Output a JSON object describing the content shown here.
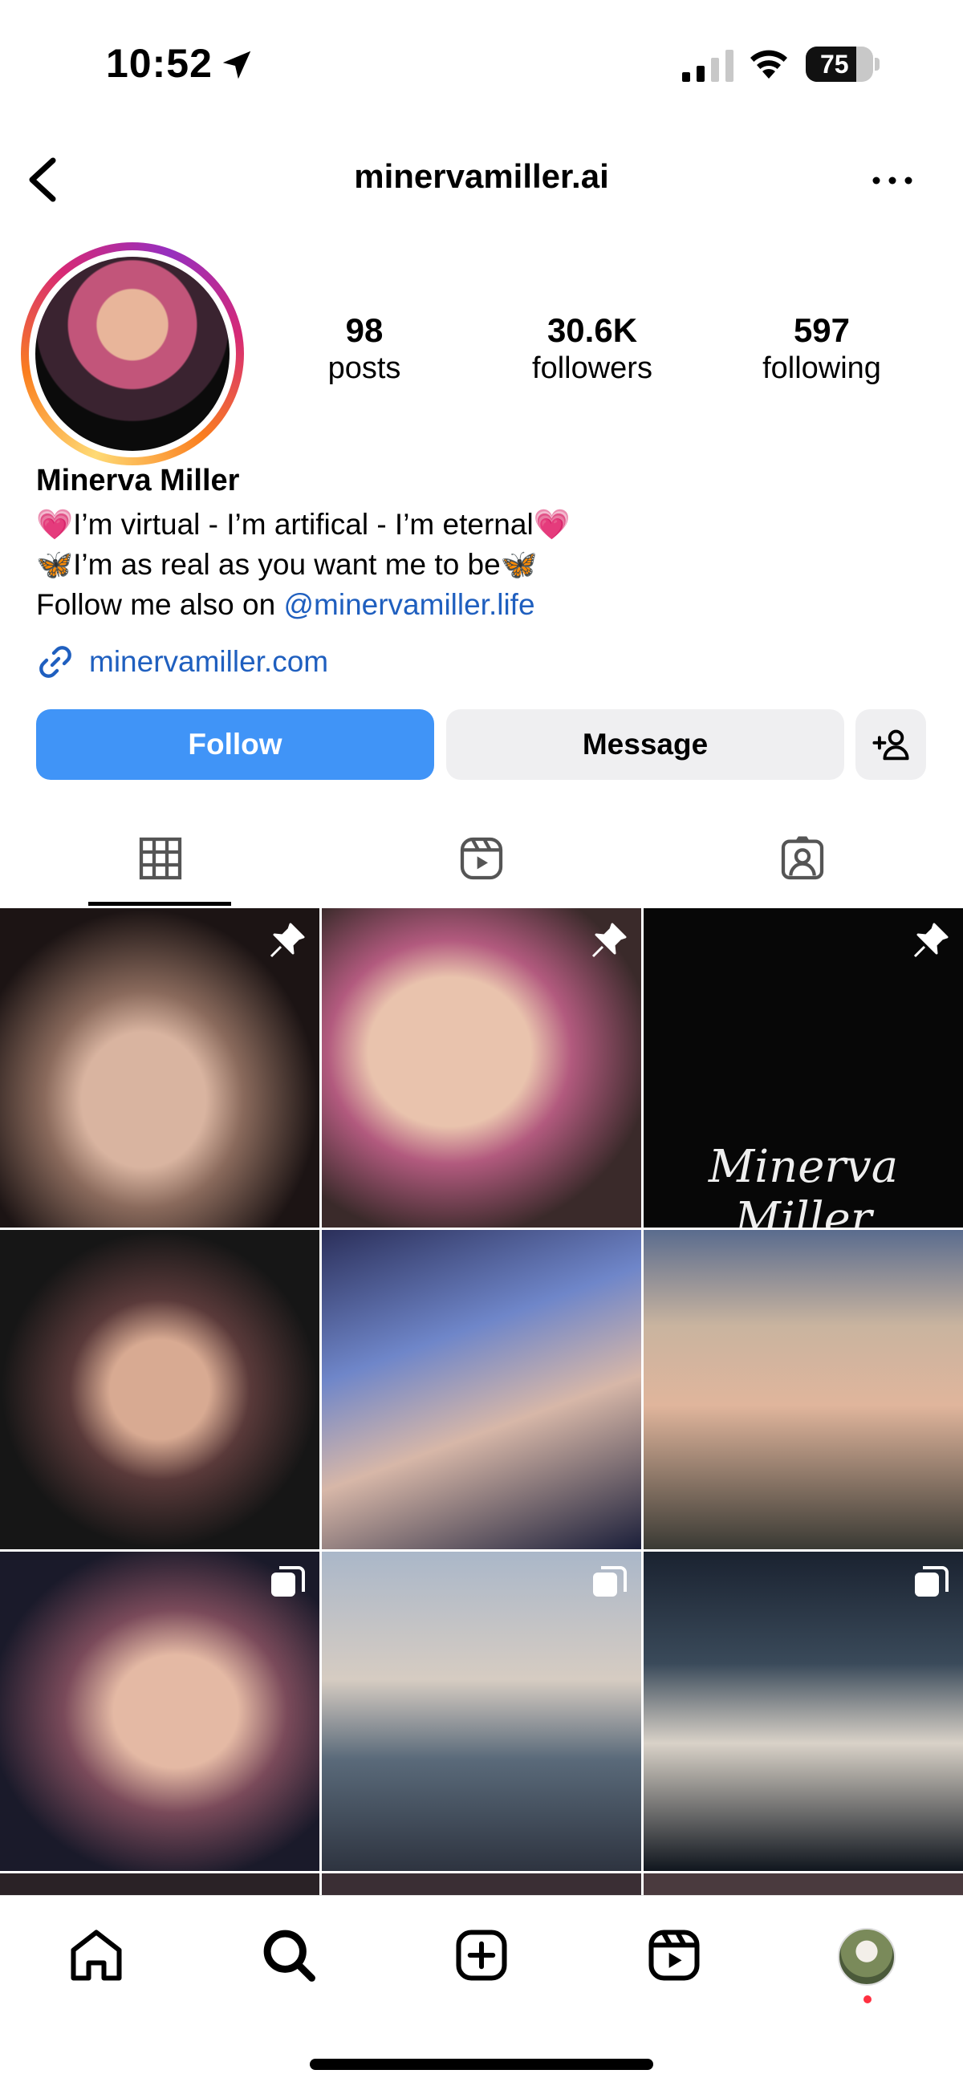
{
  "status_bar": {
    "time": "10:52",
    "battery": "75",
    "battery_level": 0.75
  },
  "header": {
    "username": "minervamiller.ai"
  },
  "profile": {
    "stats": [
      {
        "value": "98",
        "label": "posts"
      },
      {
        "value": "30.6K",
        "label": "followers"
      },
      {
        "value": "597",
        "label": "following"
      }
    ],
    "name": "Minerva Miller",
    "bio_line1": "💗I’m virtual - I’m artifical - I’m eternal💗",
    "bio_line2": "🦋I’m as real as you want me to be🦋",
    "bio_line3_prefix": "Follow me also on ",
    "bio_mention": "@minervamiller.life",
    "link": "minervamiller.com"
  },
  "actions": {
    "follow": "Follow",
    "message": "Message"
  },
  "tabs": [
    "grid-icon",
    "reels-icon",
    "tagged-icon"
  ],
  "grid": {
    "signature_text": "Minerva Miller",
    "tiles": [
      {
        "badge": "pin"
      },
      {
        "badge": "pin"
      },
      {
        "badge": "pin"
      },
      {
        "badge": ""
      },
      {
        "badge": ""
      },
      {
        "badge": ""
      },
      {
        "badge": "multi"
      },
      {
        "badge": "multi"
      },
      {
        "badge": "multi"
      }
    ]
  },
  "bottom_nav": [
    "home-icon",
    "search-icon",
    "create-icon",
    "reels-icon",
    "profile-avatar"
  ],
  "colors": {
    "follow_button": "#4094f7",
    "link_blue": "#1f5fbf",
    "secondary_button": "#efeff1"
  }
}
